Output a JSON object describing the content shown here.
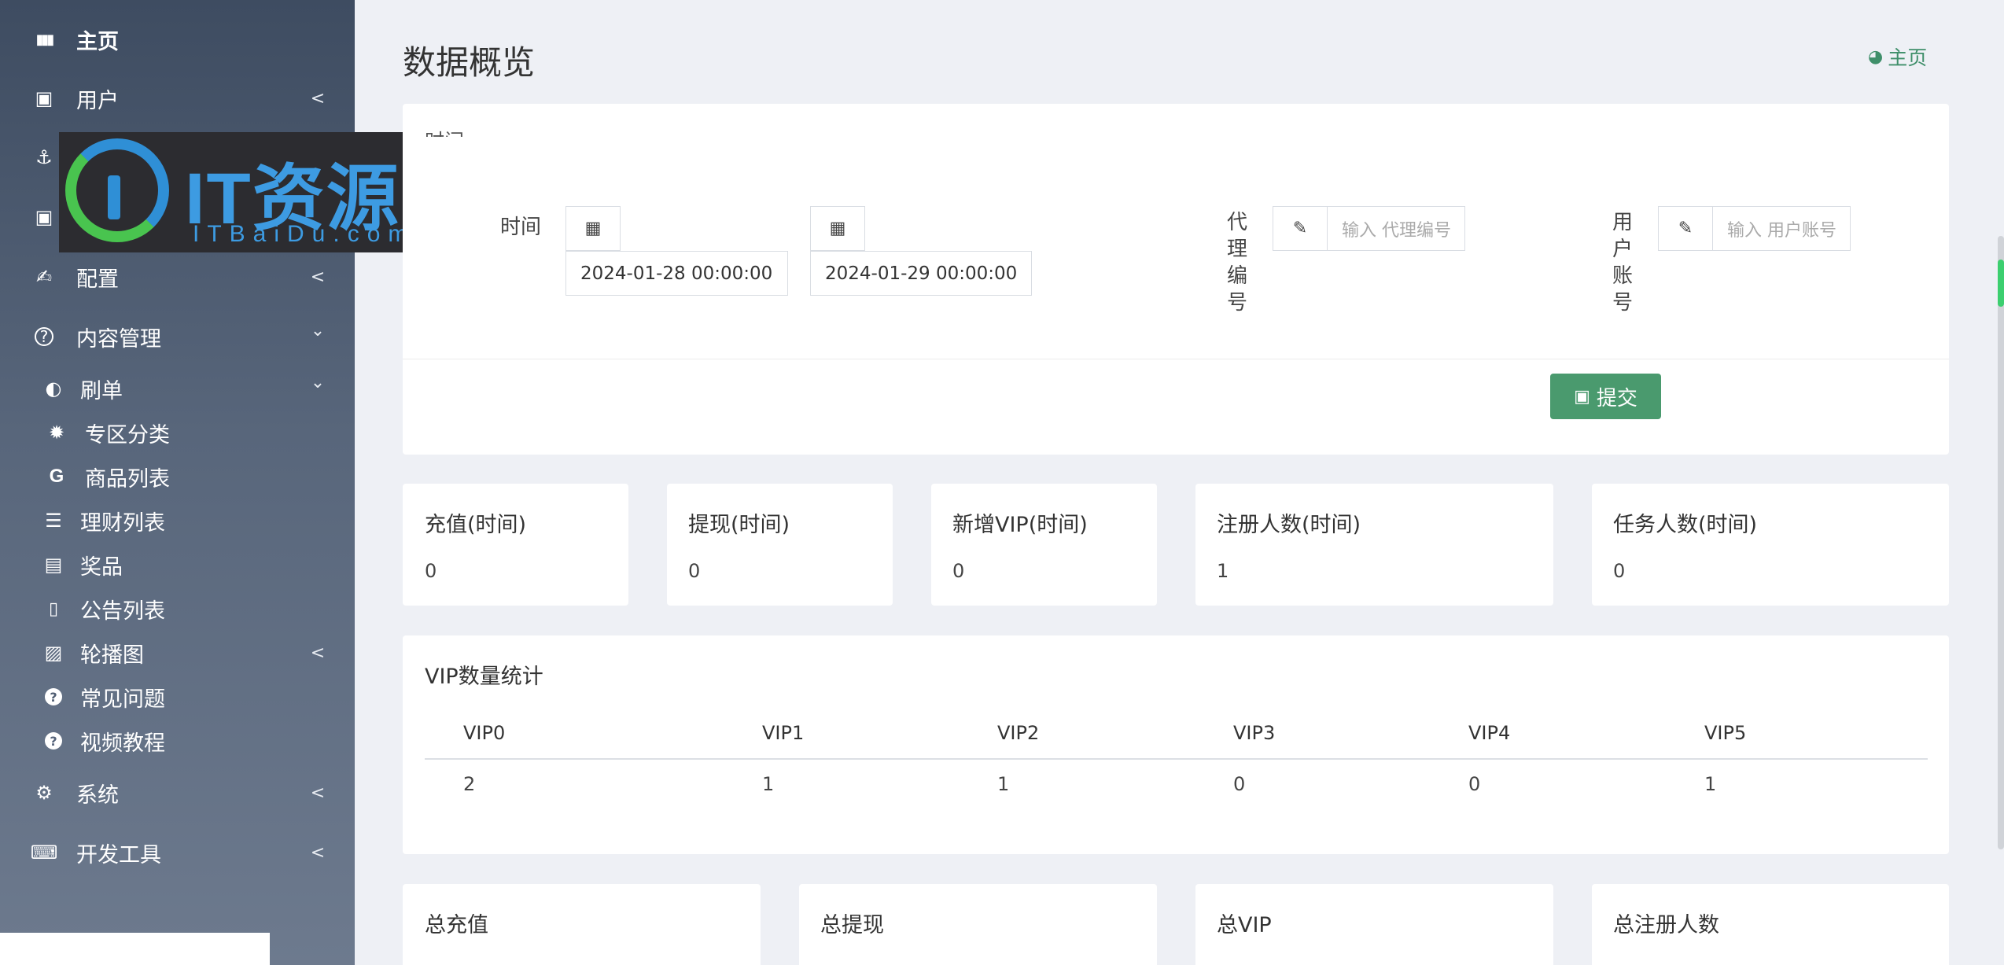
{
  "sidebar": {
    "items": [
      {
        "label": "主页",
        "icon": "bar-chart-icon",
        "glyph": "❙❙❙"
      },
      {
        "label": "用户",
        "icon": "user-card-icon",
        "glyph": "▣",
        "chevron": "<"
      },
      {
        "label": "",
        "icon": "anchor-icon",
        "glyph": "⚓"
      },
      {
        "label": "",
        "icon": "contact-card-icon",
        "glyph": "▣"
      },
      {
        "label": "配置",
        "icon": "signing-hand-icon",
        "glyph": "✍",
        "chevron": "<"
      },
      {
        "label": "内容管理",
        "icon": "question-circle-icon",
        "glyph": "?",
        "chevron": "⌄"
      },
      {
        "label": "刷单",
        "icon": "half-circle-icon",
        "glyph": "◐",
        "chevron": "⌄"
      },
      {
        "label": "专区分类",
        "icon": "gear-burst-icon",
        "glyph": "✹"
      },
      {
        "label": "商品列表",
        "icon": "google-g-icon",
        "glyph": "G"
      },
      {
        "label": "理财列表",
        "icon": "list-indent-icon",
        "glyph": "☰"
      },
      {
        "label": "奖品",
        "icon": "money-bill-icon",
        "glyph": "▤"
      },
      {
        "label": "公告列表",
        "icon": "document-icon",
        "glyph": "❙"
      },
      {
        "label": "轮播图",
        "icon": "image-file-icon",
        "glyph": "▨",
        "chevron": "<"
      },
      {
        "label": "常见问题",
        "icon": "question-icon",
        "glyph": "?"
      },
      {
        "label": "视频教程",
        "icon": "question-icon",
        "glyph": "?"
      },
      {
        "label": "系统",
        "icon": "gear-icon",
        "glyph": "⚙",
        "chevron": "<"
      },
      {
        "label": "开发工具",
        "icon": "keyboard-icon",
        "glyph": "⌨",
        "chevron": "<"
      }
    ]
  },
  "watermark": {
    "title": "IT资源网",
    "subtitle": "ITBaiDu.com"
  },
  "header": {
    "title": "数据概览",
    "home_link": "主页"
  },
  "filter": {
    "legend": "时间",
    "time_label": "时间",
    "start_date": "2024-01-28 00:00:00",
    "end_date": "2024-01-29 00:00:00",
    "agent_label": "代理编号",
    "agent_chars": [
      "代",
      "理",
      "编",
      "号"
    ],
    "agent_placeholder": "输入 代理编号",
    "user_chars": [
      "用",
      "户",
      "账",
      "号"
    ],
    "user_placeholder": "输入 用户账号",
    "submit_label": "提交"
  },
  "stats": [
    {
      "title": "充值(时间)",
      "value": "0"
    },
    {
      "title": "提现(时间)",
      "value": "0"
    },
    {
      "title": "新增VIP(时间)",
      "value": "0"
    },
    {
      "title": "注册人数(时间)",
      "value": "1"
    },
    {
      "title": "任务人数(时间)",
      "value": "0"
    }
  ],
  "vip": {
    "title": "VIP数量统计",
    "headers": [
      "VIP0",
      "VIP1",
      "VIP2",
      "VIP3",
      "VIP4",
      "VIP5"
    ],
    "values": [
      "2",
      "1",
      "1",
      "0",
      "0",
      "1"
    ]
  },
  "totals": [
    {
      "title": "总充值"
    },
    {
      "title": "总提现"
    },
    {
      "title": "总VIP"
    },
    {
      "title": "总注册人数"
    }
  ],
  "colors": {
    "accent": "#4a9a6e",
    "link": "#3f8f6a",
    "sidebar_top": "#3e4c61",
    "sidebar_bottom": "#6d7a8e"
  }
}
